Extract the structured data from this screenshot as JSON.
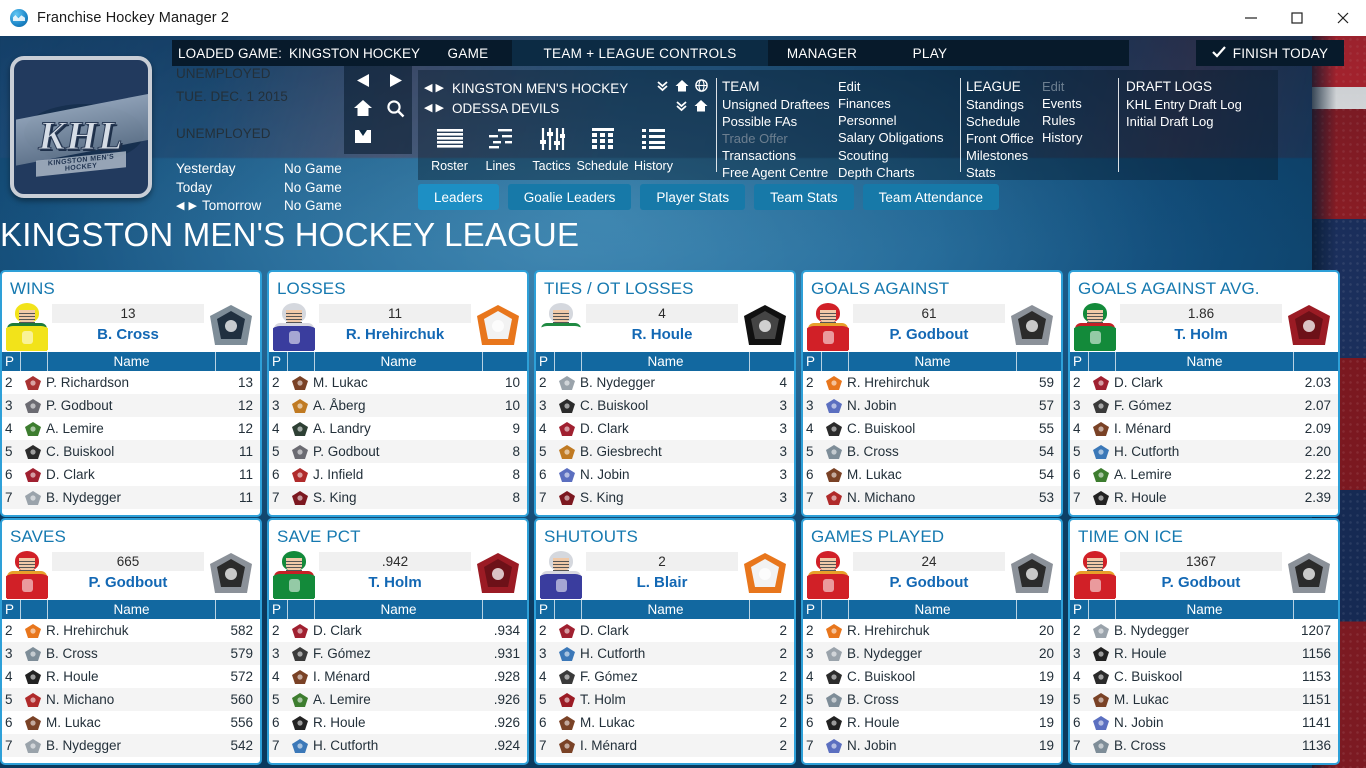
{
  "window": {
    "title": "Franchise Hockey Manager 2",
    "app_icon": "fhm-globe-icon",
    "minimize": "–",
    "maximize": "□",
    "close": "✕"
  },
  "topbar": {
    "loaded_game_label": "LOADED GAME:",
    "loaded_game_value": "KINGSTON HOCKEY LEA",
    "tabs": [
      {
        "label": "GAME",
        "active": false
      },
      {
        "label": "TEAM + LEAGUE CONTROLS",
        "active": true
      },
      {
        "label": "MANAGER",
        "active": false
      },
      {
        "label": "PLAY",
        "active": false
      }
    ],
    "finish_today": "FINISH TODAY",
    "finish_today_icon": "check-icon"
  },
  "left_panel": {
    "logo": {
      "name": "khl-team-logo",
      "text": "KHL",
      "subtext": "KINGSTON MEN'S HOCKEY"
    },
    "status_line_1": "UNEMPLOYED",
    "date": "TUE. DEC. 1 2015",
    "status_line_2": "UNEMPLOYED",
    "schedule": [
      {
        "day": "Yesterday",
        "result": "No Game",
        "has_arrows": false
      },
      {
        "day": "Today",
        "result": "No Game",
        "has_arrows": false
      },
      {
        "day": "Tomorrow",
        "result": "No Game",
        "has_arrows": true
      }
    ]
  },
  "navpad": {
    "buttons": [
      {
        "name": "back-arrow-icon"
      },
      {
        "name": "forward-arrow-icon"
      },
      {
        "name": "home-icon"
      },
      {
        "name": "search-icon"
      },
      {
        "name": "inbox-icon"
      }
    ]
  },
  "selector": {
    "league": "KINGSTON MEN'S HOCKEY LEA",
    "team": "ODESSA DEVILS",
    "league_icons": [
      "chevron-double-down-icon",
      "home-icon",
      "globe-icon"
    ],
    "team_icons": [
      "chevron-double-down-icon",
      "home-icon"
    ]
  },
  "modules": [
    {
      "label": "Roster",
      "icon": "roster-lines-icon"
    },
    {
      "label": "Lines",
      "icon": "lines-icon"
    },
    {
      "label": "Tactics",
      "icon": "sliders-icon"
    },
    {
      "label": "Schedule",
      "icon": "calendar-grid-icon"
    },
    {
      "label": "History",
      "icon": "list-icon"
    }
  ],
  "megamenu": {
    "team": {
      "header": "TEAM",
      "col1": [
        {
          "label": "Unsigned Draftees",
          "disabled": false
        },
        {
          "label": "Possible FAs",
          "disabled": false
        },
        {
          "label": "Trade Offer",
          "disabled": true
        },
        {
          "label": "Transactions",
          "disabled": false
        },
        {
          "label": "Free Agent Centre",
          "disabled": false
        }
      ],
      "col2": [
        {
          "label": "Edit",
          "disabled": false
        },
        {
          "label": "Finances",
          "disabled": false
        },
        {
          "label": "Personnel",
          "disabled": false
        },
        {
          "label": "Salary Obligations",
          "disabled": false
        },
        {
          "label": "Scouting",
          "disabled": false
        },
        {
          "label": "Depth Charts",
          "disabled": false
        }
      ]
    },
    "league": {
      "header": "LEAGUE",
      "col1": [
        {
          "label": "Standings",
          "disabled": false
        },
        {
          "label": "Schedule",
          "disabled": false
        },
        {
          "label": "Front Office",
          "disabled": false
        },
        {
          "label": "Milestones",
          "disabled": false
        },
        {
          "label": "Stats",
          "disabled": false
        }
      ],
      "col2": [
        {
          "label": "Edit",
          "disabled": true
        },
        {
          "label": "Events",
          "disabled": false
        },
        {
          "label": "Rules",
          "disabled": false
        },
        {
          "label": "History",
          "disabled": false
        }
      ]
    },
    "draft_logs": {
      "header": "DRAFT LOGS",
      "items": [
        {
          "label": "KHL Entry Draft Log",
          "disabled": false
        },
        {
          "label": "Initial Draft Log",
          "disabled": false
        }
      ]
    }
  },
  "subtabs": [
    {
      "label": "Leaders",
      "active": true
    },
    {
      "label": "Goalie Leaders",
      "active": false
    },
    {
      "label": "Player Stats",
      "active": false
    },
    {
      "label": "Team Stats",
      "active": false
    },
    {
      "label": "Team Attendance",
      "active": false
    }
  ],
  "page_title": "KINGSTON MEN'S HOCKEY LEAGUE",
  "columns": {
    "rank": "P",
    "name": "Name"
  },
  "cards": [
    {
      "title": "WINS",
      "leader": {
        "value": "13",
        "name": "B. Cross",
        "portrait": {
          "jersey": "#f2e31a",
          "trim": "#1c7a3a",
          "helmet": "#f2e31a"
        },
        "team_logo": "nighthawks-diamond-logo",
        "logo_colors": [
          "#7e8d98",
          "#203040"
        ]
      },
      "rows": [
        {
          "rank": "2",
          "name": "P. Richardson",
          "value": "13",
          "logo": "#a83232"
        },
        {
          "rank": "3",
          "name": "P. Godbout",
          "value": "12",
          "logo": "#6b6b72"
        },
        {
          "rank": "4",
          "name": "A. Lemire",
          "value": "12",
          "logo": "#3d7d2f"
        },
        {
          "rank": "5",
          "name": "C. Buiskool",
          "value": "11",
          "logo": "#2b2b2b"
        },
        {
          "rank": "6",
          "name": "D. Clark",
          "value": "11",
          "logo": "#a02030"
        },
        {
          "rank": "7",
          "name": "B. Nydegger",
          "value": "11",
          "logo": "#9aa3ab"
        }
      ]
    },
    {
      "title": "LOSSES",
      "leader": {
        "value": "11",
        "name": "R. Hrehirchuk",
        "portrait": {
          "jersey": "#3a3d9e",
          "trim": "#d8d8e0",
          "helmet": "#d5d8de"
        },
        "team_logo": "wizards-flame-logo",
        "logo_colors": [
          "#e8761c",
          "#f2f2f2"
        ]
      },
      "rows": [
        {
          "rank": "2",
          "name": "M. Lukac",
          "value": "10",
          "logo": "#7a4226"
        },
        {
          "rank": "3",
          "name": "A. Åberg",
          "value": "10",
          "logo": "#c07a22"
        },
        {
          "rank": "4",
          "name": "A. Landry",
          "value": "9",
          "logo": "#2e4034"
        },
        {
          "rank": "5",
          "name": "P. Godbout",
          "value": "8",
          "logo": "#6b6b72"
        },
        {
          "rank": "6",
          "name": "J. Infield",
          "value": "8",
          "logo": "#b02a2a"
        },
        {
          "rank": "7",
          "name": "S. King",
          "value": "8",
          "logo": "#7c1820"
        }
      ]
    },
    {
      "title": "TIES / OT LOSSES",
      "leader": {
        "value": "4",
        "name": "R. Houle",
        "portrait": {
          "jersey": "#ffffff",
          "trim": "#1f8a42",
          "helmet": "#d5d8de"
        },
        "team_logo": "gulls-script-logo",
        "logo_colors": [
          "#111111",
          "#444444"
        ]
      },
      "rows": [
        {
          "rank": "2",
          "name": "B. Nydegger",
          "value": "4",
          "logo": "#9aa3ab"
        },
        {
          "rank": "3",
          "name": "C. Buiskool",
          "value": "3",
          "logo": "#2b2b2b"
        },
        {
          "rank": "4",
          "name": "D. Clark",
          "value": "3",
          "logo": "#a02030"
        },
        {
          "rank": "5",
          "name": "B. Giesbrecht",
          "value": "3",
          "logo": "#c07a22"
        },
        {
          "rank": "6",
          "name": "N. Jobin",
          "value": "3",
          "logo": "#5b6fc0"
        },
        {
          "rank": "7",
          "name": "S. King",
          "value": "3",
          "logo": "#7c1820"
        }
      ]
    },
    {
      "title": "GOALS AGAINST",
      "leader": {
        "value": "61",
        "name": "P. Godbout",
        "portrait": {
          "jersey": "#d12027",
          "trim": "#e8a02a",
          "helmet": "#d12027"
        },
        "team_logo": "raccoons-logo",
        "logo_colors": [
          "#8b9199",
          "#2b2b2b"
        ]
      },
      "rows": [
        {
          "rank": "2",
          "name": "R. Hrehirchuk",
          "value": "59",
          "logo": "#e8761c"
        },
        {
          "rank": "3",
          "name": "N. Jobin",
          "value": "57",
          "logo": "#5b6fc0"
        },
        {
          "rank": "4",
          "name": "C. Buiskool",
          "value": "55",
          "logo": "#2b2b2b"
        },
        {
          "rank": "5",
          "name": "B. Cross",
          "value": "54",
          "logo": "#7e8d98"
        },
        {
          "rank": "6",
          "name": "M. Lukac",
          "value": "54",
          "logo": "#7a4226"
        },
        {
          "rank": "7",
          "name": "N. Michano",
          "value": "53",
          "logo": "#b02a2a"
        }
      ]
    },
    {
      "title": "GOALS AGAINST AVG.",
      "leader": {
        "value": "1.86",
        "name": "T. Holm",
        "portrait": {
          "jersey": "#138a3a",
          "trim": "#c62026",
          "helmet": "#138a3a"
        },
        "team_logo": "ufa-logo",
        "logo_colors": [
          "#9b1b24",
          "#6d1118"
        ]
      },
      "rows": [
        {
          "rank": "2",
          "name": "D. Clark",
          "value": "2.03",
          "logo": "#a02030"
        },
        {
          "rank": "3",
          "name": "F. Gómez",
          "value": "2.07",
          "logo": "#3a3a3a"
        },
        {
          "rank": "4",
          "name": "I. Ménard",
          "value": "2.09",
          "logo": "#7a4226"
        },
        {
          "rank": "5",
          "name": "H. Cutforth",
          "value": "2.20",
          "logo": "#3b78b8"
        },
        {
          "rank": "6",
          "name": "A. Lemire",
          "value": "2.22",
          "logo": "#3d7d2f"
        },
        {
          "rank": "7",
          "name": "R. Houle",
          "value": "2.39",
          "logo": "#222222"
        }
      ]
    },
    {
      "title": "SAVES",
      "leader": {
        "value": "665",
        "name": "P. Godbout",
        "portrait": {
          "jersey": "#d12027",
          "trim": "#e8a02a",
          "helmet": "#d12027"
        },
        "team_logo": "raccoons-logo",
        "logo_colors": [
          "#8b9199",
          "#2b2b2b"
        ]
      },
      "rows": [
        {
          "rank": "2",
          "name": "R. Hrehirchuk",
          "value": "582",
          "logo": "#e8761c"
        },
        {
          "rank": "3",
          "name": "B. Cross",
          "value": "579",
          "logo": "#7e8d98"
        },
        {
          "rank": "4",
          "name": "R. Houle",
          "value": "572",
          "logo": "#222222"
        },
        {
          "rank": "5",
          "name": "N. Michano",
          "value": "560",
          "logo": "#b02a2a"
        },
        {
          "rank": "6",
          "name": "M. Lukac",
          "value": "556",
          "logo": "#7a4226"
        },
        {
          "rank": "7",
          "name": "B. Nydegger",
          "value": "542",
          "logo": "#9aa3ab"
        }
      ]
    },
    {
      "title": "SAVE PCT",
      "leader": {
        "value": ".942",
        "name": "T. Holm",
        "portrait": {
          "jersey": "#138a3a",
          "trim": "#c62026",
          "helmet": "#138a3a"
        },
        "team_logo": "ufa-logo",
        "logo_colors": [
          "#9b1b24",
          "#6d1118"
        ]
      },
      "rows": [
        {
          "rank": "2",
          "name": "D. Clark",
          "value": ".934",
          "logo": "#a02030"
        },
        {
          "rank": "3",
          "name": "F. Gómez",
          "value": ".931",
          "logo": "#3a3a3a"
        },
        {
          "rank": "4",
          "name": "I. Ménard",
          "value": ".928",
          "logo": "#7a4226"
        },
        {
          "rank": "5",
          "name": "A. Lemire",
          "value": ".926",
          "logo": "#3d7d2f"
        },
        {
          "rank": "6",
          "name": "R. Houle",
          "value": ".926",
          "logo": "#222222"
        },
        {
          "rank": "7",
          "name": "H. Cutforth",
          "value": ".924",
          "logo": "#3b78b8"
        }
      ]
    },
    {
      "title": "SHUTOUTS",
      "leader": {
        "value": "2",
        "name": "L. Blair",
        "portrait": {
          "jersey": "#3a3d9e",
          "trim": "#d8d8e0",
          "helmet": "#d5d8de"
        },
        "team_logo": "wizards-flame-logo",
        "logo_colors": [
          "#e8761c",
          "#f2f2f2"
        ]
      },
      "rows": [
        {
          "rank": "2",
          "name": "D. Clark",
          "value": "2",
          "logo": "#a02030"
        },
        {
          "rank": "3",
          "name": "H. Cutforth",
          "value": "2",
          "logo": "#3b78b8"
        },
        {
          "rank": "4",
          "name": "F. Gómez",
          "value": "2",
          "logo": "#3a3a3a"
        },
        {
          "rank": "5",
          "name": "T. Holm",
          "value": "2",
          "logo": "#9b1b24"
        },
        {
          "rank": "6",
          "name": "M. Lukac",
          "value": "2",
          "logo": "#7a4226"
        },
        {
          "rank": "7",
          "name": "I. Ménard",
          "value": "2",
          "logo": "#7a4226"
        }
      ]
    },
    {
      "title": "GAMES PLAYED",
      "leader": {
        "value": "24",
        "name": "P. Godbout",
        "portrait": {
          "jersey": "#d12027",
          "trim": "#e8a02a",
          "helmet": "#d12027"
        },
        "team_logo": "raccoons-logo",
        "logo_colors": [
          "#8b9199",
          "#2b2b2b"
        ]
      },
      "rows": [
        {
          "rank": "2",
          "name": "R. Hrehirchuk",
          "value": "20",
          "logo": "#e8761c"
        },
        {
          "rank": "3",
          "name": "B. Nydegger",
          "value": "20",
          "logo": "#9aa3ab"
        },
        {
          "rank": "4",
          "name": "C. Buiskool",
          "value": "19",
          "logo": "#2b2b2b"
        },
        {
          "rank": "5",
          "name": "B. Cross",
          "value": "19",
          "logo": "#7e8d98"
        },
        {
          "rank": "6",
          "name": "R. Houle",
          "value": "19",
          "logo": "#222222"
        },
        {
          "rank": "7",
          "name": "N. Jobin",
          "value": "19",
          "logo": "#5b6fc0"
        }
      ]
    },
    {
      "title": "TIME ON ICE",
      "leader": {
        "value": "1367",
        "name": "P. Godbout",
        "portrait": {
          "jersey": "#d12027",
          "trim": "#e8a02a",
          "helmet": "#d12027"
        },
        "team_logo": "raccoons-logo",
        "logo_colors": [
          "#8b9199",
          "#2b2b2b"
        ]
      },
      "rows": [
        {
          "rank": "2",
          "name": "B. Nydegger",
          "value": "1207",
          "logo": "#9aa3ab"
        },
        {
          "rank": "3",
          "name": "R. Houle",
          "value": "1156",
          "logo": "#222222"
        },
        {
          "rank": "4",
          "name": "C. Buiskool",
          "value": "1153",
          "logo": "#2b2b2b"
        },
        {
          "rank": "5",
          "name": "M. Lukac",
          "value": "1151",
          "logo": "#7a4226"
        },
        {
          "rank": "6",
          "name": "N. Jobin",
          "value": "1141",
          "logo": "#5b6fc0"
        },
        {
          "rank": "7",
          "name": "B. Cross",
          "value": "1136",
          "logo": "#7e8d98"
        }
      ]
    }
  ],
  "colors": {
    "accent": "#1d8fc4",
    "card_border": "#2ea0d8",
    "table_header": "#1268a0",
    "card_title": "#1679b0",
    "leader_name": "#1368b4",
    "dark_panel": "#071a2b"
  }
}
